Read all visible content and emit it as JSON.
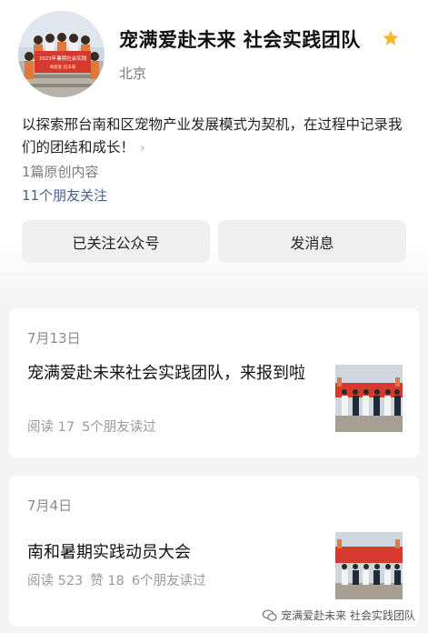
{
  "profile": {
    "name": "宠满爱赴未来 社会实践团队",
    "location": "北京",
    "description": "以探索邢台南和区宠物产业发展模式为契机，在过程中记录我们的团结和成长！",
    "original_count": "1篇原创内容",
    "friends_follow": "11个朋友关注",
    "banner_text": "2023年暑期社会实践",
    "banner_subtext": "奉献爱 担未来"
  },
  "actions": {
    "follow_label": "已关注公众号",
    "message_label": "发消息"
  },
  "articles": [
    {
      "date": "7月13日",
      "title": "宠满爱赴未来社会实践团队，来报到啦",
      "reads": "阅读 17",
      "likes": "",
      "friends_read": "5个朋友读过"
    },
    {
      "date": "7月4日",
      "title": "南和暑期实践动员大会",
      "reads": "阅读 523",
      "likes": "赞 18",
      "friends_read": "6个朋友读过"
    }
  ],
  "watermark": "宠满爱赴未来 社会实践团队",
  "colors": {
    "link": "#4a5f8a",
    "star": "#f5b82e",
    "banner_red": "#d63a2f"
  },
  "icons": [
    "star-icon",
    "chevron-right-icon",
    "wechat-icon"
  ]
}
